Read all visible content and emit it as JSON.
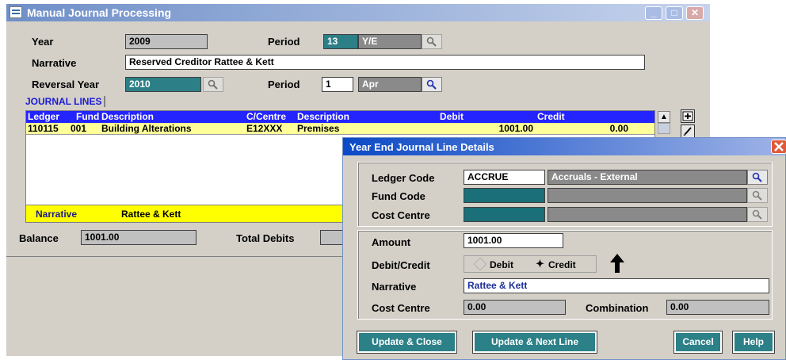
{
  "window": {
    "title": "Manual Journal Processing"
  },
  "header": {
    "year_label": "Year",
    "year_value": "2009",
    "period_label": "Period",
    "period_value": "13",
    "period_name": "Y/E",
    "narrative_label": "Narrative",
    "narrative_value": "Reserved Creditor Rattee & Kett",
    "reversal_year_label": "Reversal Year",
    "reversal_year_value": "2010",
    "reversal_period_label": "Period",
    "reversal_period_value": "1",
    "reversal_period_name": "Apr"
  },
  "journal_lines": {
    "tab_label": "JOURNAL LINES",
    "columns": [
      "Ledger",
      "Fund",
      "Description",
      "C/Centre",
      "Description",
      "Debit",
      "Credit"
    ],
    "rows": [
      {
        "ledger": "110115",
        "fund": "001",
        "description": "Building Alterations",
        "ccentre": "E12XXX",
        "cc_description": "Premises",
        "debit": "1001.00",
        "credit": "0.00"
      }
    ]
  },
  "narrative_bar": {
    "label": "Narrative",
    "value": "Rattee & Kett"
  },
  "footer": {
    "balance_label": "Balance",
    "balance_value": "1001.00",
    "total_debits_label": "Total Debits"
  },
  "dialog": {
    "title": "Year End Journal Line Details",
    "ledger_code_label": "Ledger Code",
    "ledger_code_value": "ACCRUE",
    "ledger_code_desc": "Accruals - External",
    "fund_code_label": "Fund Code",
    "cost_centre_label": "Cost Centre",
    "amount_label": "Amount",
    "amount_value": "1001.00",
    "debit_credit_label": "Debit/Credit",
    "debit_option": "Debit",
    "credit_option": "Credit",
    "selected": "Credit",
    "narrative_label": "Narrative",
    "narrative_value": "Rattee & Kett",
    "cost_centre_amount_label": "Cost Centre",
    "cost_centre_amount_value": "0.00",
    "combination_label": "Combination",
    "combination_value": "0.00",
    "buttons": {
      "update_close": "Update & Close",
      "update_next": "Update & Next Line",
      "cancel": "Cancel",
      "help": "Help"
    }
  },
  "colors": {
    "title_bar": "#6f8fc8",
    "grid_header": "#2424ff",
    "selected_row": "#ffff99",
    "teal": "#2c7f86",
    "narrative_bar": "#ffff00"
  }
}
